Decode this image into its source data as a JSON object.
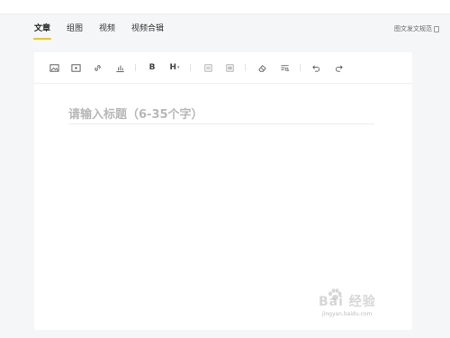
{
  "tabs": [
    {
      "label": "文章",
      "active": true
    },
    {
      "label": "组图",
      "active": false
    },
    {
      "label": "视频",
      "active": false
    },
    {
      "label": "视频合辑",
      "active": false
    }
  ],
  "guide_link": "图文发文规范",
  "toolbar": {
    "groups": [
      [
        "image-icon",
        "video-icon",
        "link-icon",
        "chart-icon"
      ],
      [
        "bold-icon",
        "heading-icon"
      ],
      [
        "quote-icon",
        "divider-icon"
      ],
      [
        "eraser-icon",
        "format-icon"
      ],
      [
        "undo-icon",
        "redo-icon"
      ]
    ],
    "bold_label": "B",
    "heading_label": "H"
  },
  "title_input": {
    "placeholder": "请输入标题（6-35个字）",
    "value": ""
  },
  "watermark": {
    "text": "Bai 经验",
    "url": "jingyan.baidu.com"
  },
  "colors": {
    "accent": "#f5c400",
    "background": "#f5f6f7",
    "card": "#ffffff",
    "placeholder": "#b8b8b8"
  }
}
